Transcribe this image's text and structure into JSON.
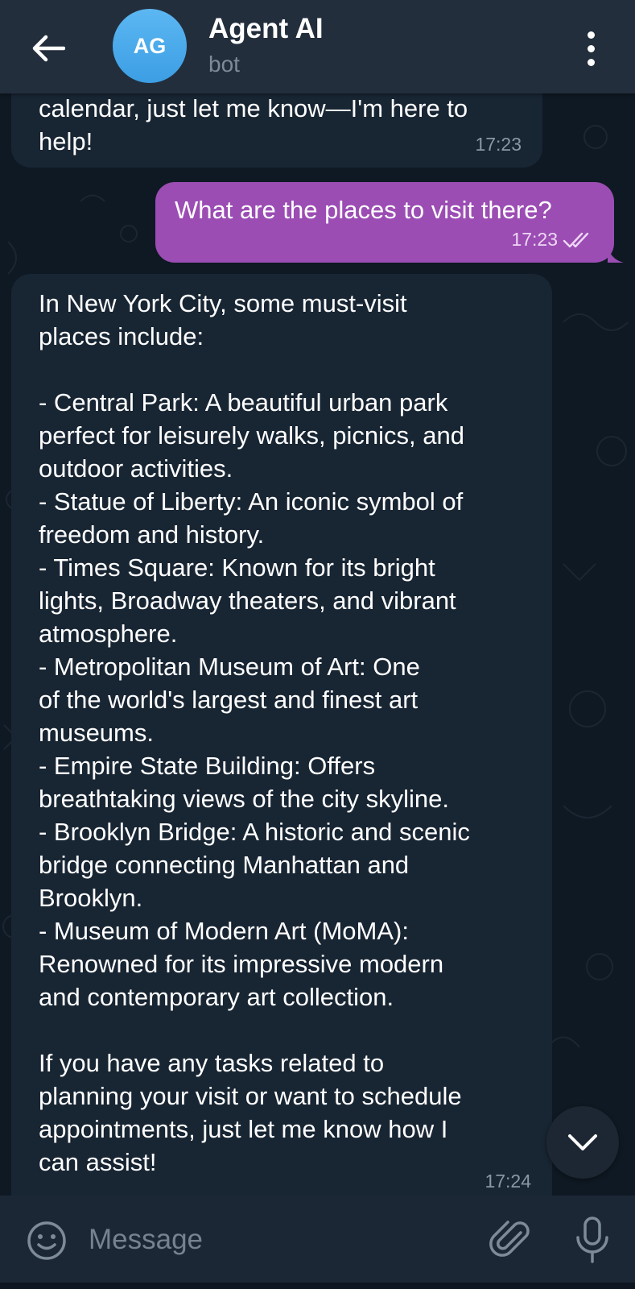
{
  "header": {
    "avatar_initials": "AG",
    "title": "Agent AI",
    "subtitle": "bot",
    "back_icon": "back-arrow-icon",
    "menu_icon": "more-vertical-icon"
  },
  "messages": [
    {
      "direction": "incoming",
      "text": "calendar, just let me know—I'm here to\nhelp!",
      "time": "17:23"
    },
    {
      "direction": "outgoing",
      "text": "What are the places to visit there?",
      "time": "17:23",
      "status_icon": "double-check-icon"
    },
    {
      "direction": "incoming",
      "text": "In New York City, some must-visit\nplaces include:\n\n- Central Park: A beautiful urban park\nperfect for leisurely walks, picnics, and\noutdoor activities.\n- Statue of Liberty: An iconic symbol of\nfreedom and history.\n- Times Square: Known for its bright\nlights, Broadway theaters, and vibrant\natmosphere.\n- Metropolitan Museum of Art: One\nof the world's largest and finest art\nmuseums.\n- Empire State Building: Offers\nbreathtaking views of the city skyline.\n- Brooklyn Bridge: A historic and scenic\nbridge connecting Manhattan and\nBrooklyn.\n- Museum of Modern Art (MoMA):\nRenowned for its impressive modern\nand contemporary art collection.\n\nIf you have any tasks related to\nplanning your visit or want to schedule\nappointments, just let me know how I\ncan assist!",
      "time": "17:24"
    }
  ],
  "input": {
    "placeholder": "Message",
    "emoji_icon": "emoji-icon",
    "attach_icon": "paperclip-icon",
    "mic_icon": "microphone-icon"
  },
  "scroll_down_icon": "chevron-down-icon",
  "colors": {
    "header_bg": "#232e3c",
    "incoming_bubble": "#182533",
    "outgoing_bubble": "#9b4db3",
    "avatar": "#4aa8ea",
    "background": "#0f1923"
  }
}
